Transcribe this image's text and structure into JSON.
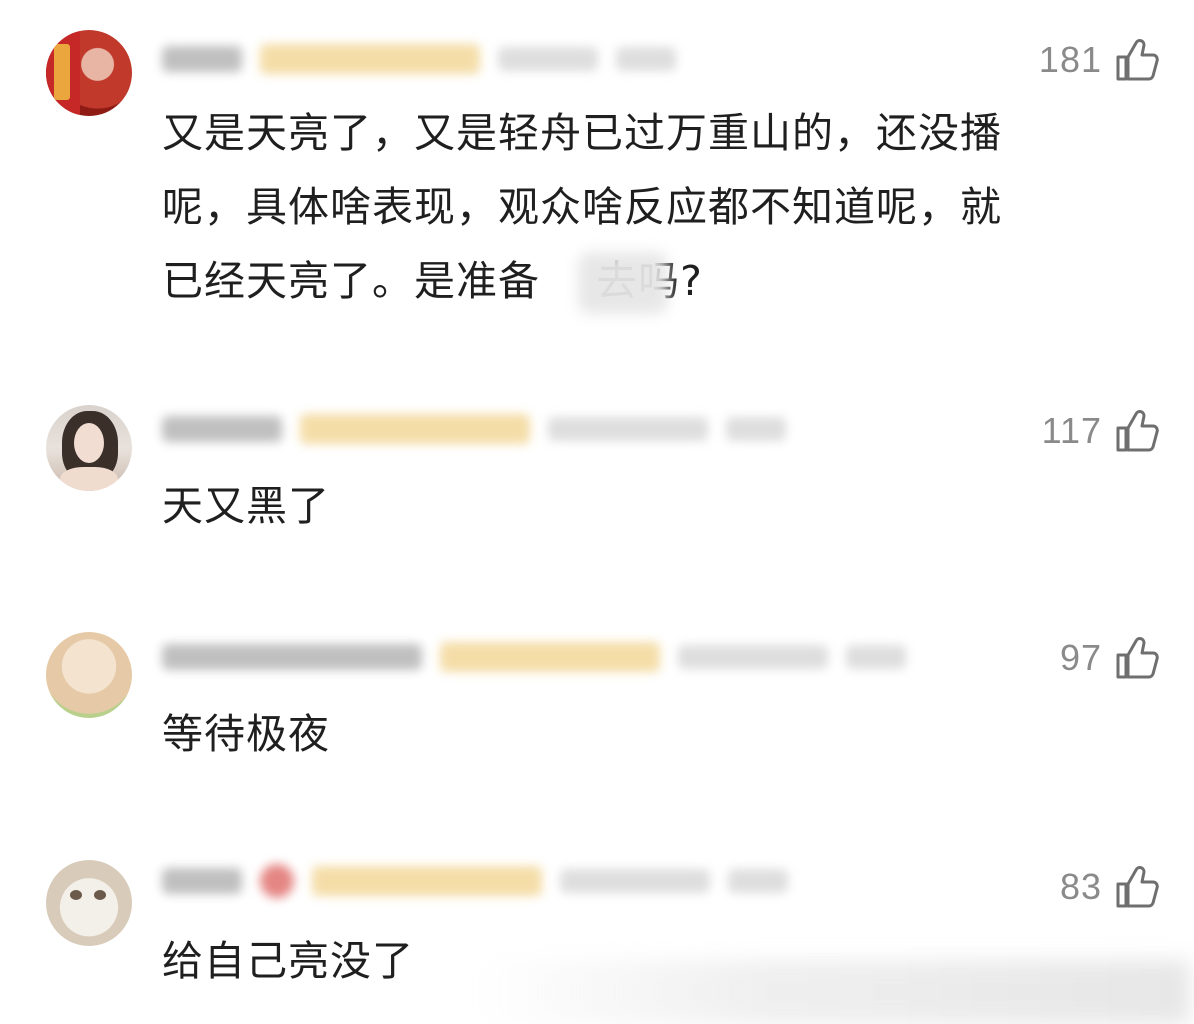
{
  "comments": [
    {
      "likes": "181",
      "text_lines": [
        "又是天亮了，又是轻舟已过万重山的，还没播",
        "呢，具体啥表现，观众啥反应都不知道呢，就",
        "已经天亮了。是准备    去吗?"
      ]
    },
    {
      "likes": "117",
      "text_lines": [
        "天又黑了"
      ]
    },
    {
      "likes": "97",
      "text_lines": [
        "等待极夜"
      ]
    },
    {
      "likes": "83",
      "text_lines": [
        "给自己亮没了"
      ]
    }
  ],
  "icons": {
    "like": "thumbs-up-icon"
  },
  "colors": {
    "text": "#1f1f1f",
    "like_count": "#8a8a8a",
    "tag": "#f1d28a"
  }
}
